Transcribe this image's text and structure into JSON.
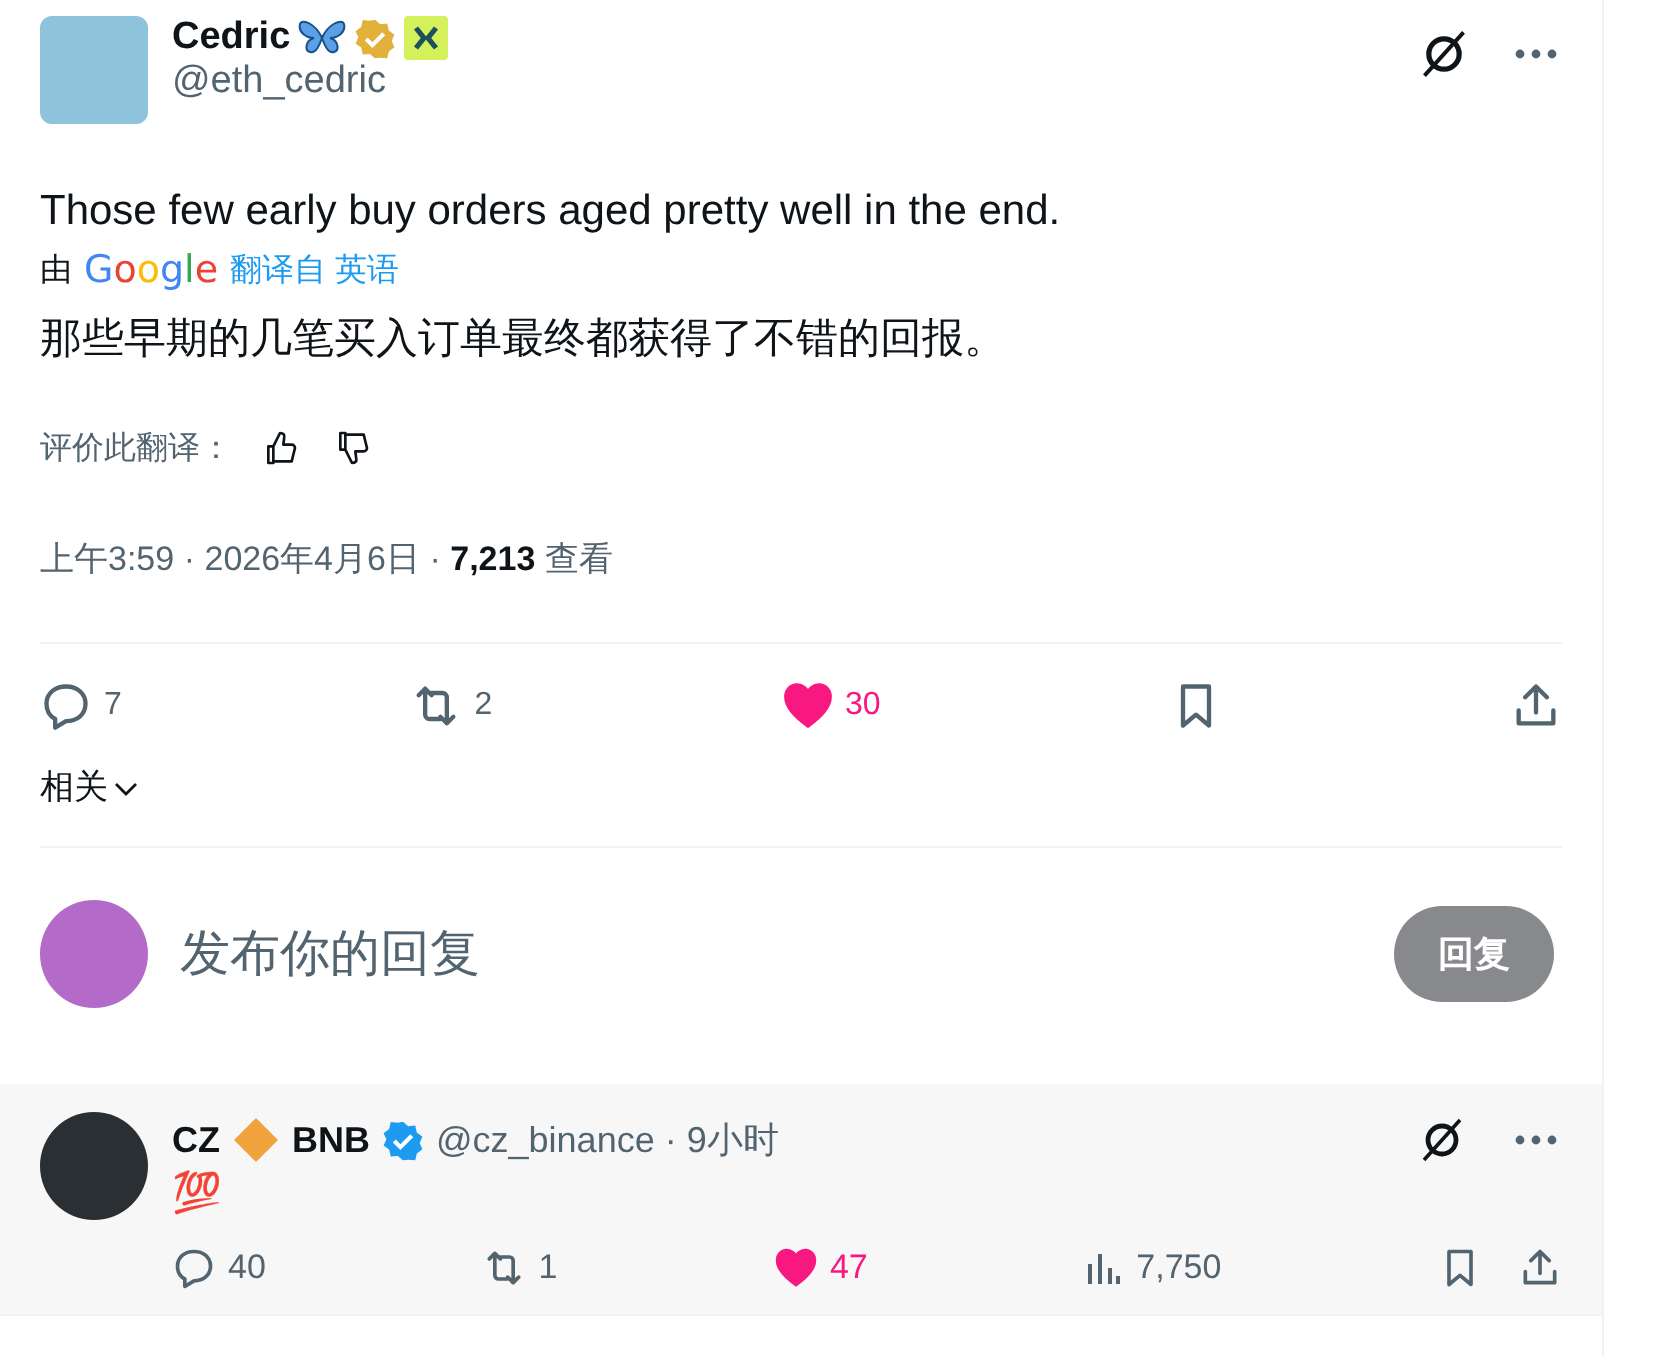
{
  "tweet": {
    "name": "Cedric",
    "handle": "@eth_cedric",
    "text": "Those few early buy orders aged pretty well in the end.",
    "translation": {
      "by": "由",
      "brand": "Google",
      "source": "翻译自 英语",
      "text": "那些早期的几笔买入订单最终都获得了不错的回报。",
      "rate_label": "评价此翻译："
    },
    "meta": {
      "separator": "·",
      "time": "上午3:59",
      "date": "2026年4月6日",
      "views": "7,213",
      "views_label": "查看"
    },
    "actions": {
      "replies": "7",
      "reposts": "2",
      "likes": "30",
      "liked": true
    },
    "related": "相关"
  },
  "compose": {
    "placeholder": "发布你的回复",
    "button": "回复",
    "disabled": true
  },
  "replies": [
    {
      "name": "CZ",
      "badge_name": "BNB",
      "handle": "@cz_binance",
      "separator": "·",
      "time": "9小时",
      "text": "💯",
      "replies": "40",
      "reposts": "1",
      "likes": "47",
      "liked": true,
      "views": "7,750"
    }
  ]
}
